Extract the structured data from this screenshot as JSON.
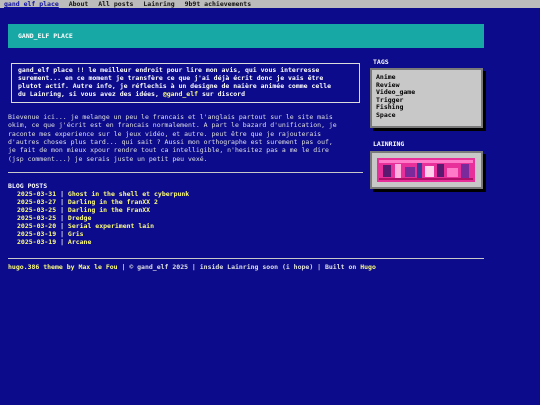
{
  "nav": {
    "brand": "gand_elf place",
    "items": [
      "About",
      "All posts",
      "Lainring",
      "9b9t achievements"
    ]
  },
  "header": {
    "title": "GAND_ELF PLACE"
  },
  "intro": {
    "text": "gand_elf place !! le meilleur endroit pour lire mon avis, qui vous interresse\nsurement... en ce moment je transfère ce que j'ai déjà écrit donc je vais être\nplutot actif. Autre info, je réflechis à un designe de naière animée comme celle\ndu Lainring, si vous avez des idées,",
    "handle": "@gand_elf",
    "suffix": " sur discord"
  },
  "welcome": "Bievenue ici... je melange un peu le francais et l'anglais partout sur le site mais\nokim, ce que j'écrit est en francais normalement. A part le bazard d'unification, je\nraconte mes experience sur le jeux vidéo, et autre. peut être que je rajouterais\nd'autres choses plus tard... qui sait ? Aussi mon orthographe est surement pas ouf,\nje fait de mon mieux xpour rendre tout ca intelligible, n'hesitez pas a me le dire\n(jsp comment...) je serais juste un petit peu vexé.",
  "blog": {
    "title": "BLOG POSTS",
    "separator": "|",
    "posts": [
      {
        "date": "2025-03-31",
        "title": "Ghost in the shell et cyberpunk"
      },
      {
        "date": "2025-03-27",
        "title": "Darling in the franXX 2"
      },
      {
        "date": "2025-03-25",
        "title": "Darling in the FranXX"
      },
      {
        "date": "2025-03-25",
        "title": "Dredge"
      },
      {
        "date": "2025-03-20",
        "title": "Serial experiment lain"
      },
      {
        "date": "2025-03-19",
        "title": "Gris"
      },
      {
        "date": "2025-03-19",
        "title": "Arcane"
      }
    ]
  },
  "sidebar": {
    "tags_title": "TAGS",
    "tags": [
      "Anime",
      "Review",
      "Video_game",
      "Trigger",
      "Fishing",
      "Space"
    ],
    "lainring_title": "LAINRING"
  },
  "footer": {
    "theme": "hugo.386 theme by Max le Fou",
    "middle": " | © gand_elf 2025 | inside Lainring soon (i hope) | Built on ",
    "built": "Hugo"
  },
  "colors": {
    "background": "#0b0b8c",
    "header": "#17a7a4",
    "accent_yellow": "#ffff7a",
    "panel": "#c8c8c8",
    "lainring_pink": "#e8309a"
  }
}
